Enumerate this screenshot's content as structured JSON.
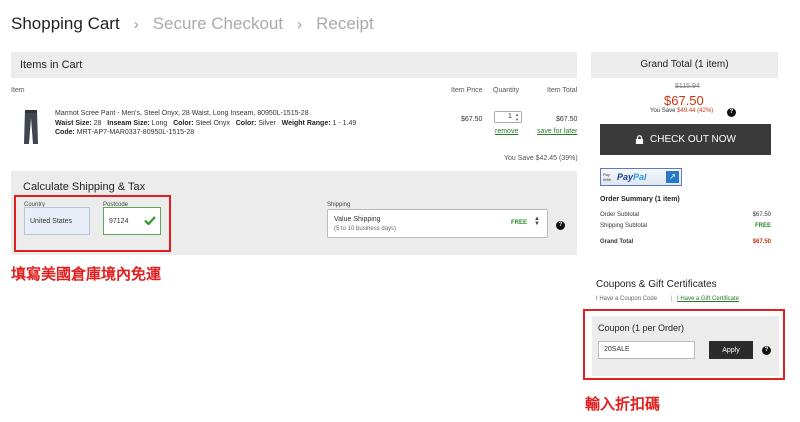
{
  "breadcrumb": {
    "step1": "Shopping Cart",
    "step2": "Secure Checkout",
    "step3": "Receipt",
    "sep": "›"
  },
  "cart": {
    "header": "Items in Cart",
    "col_item": "Item",
    "col_price": "Item Price",
    "col_qty": "Quantity",
    "col_total": "Item Total",
    "product_name": "Marmot Scree Pant - Men's, Steel Onyx, 28 Waist, Long Inseam, 80950L-1515-28",
    "waist_label": "Waist Size:",
    "waist_value": "28",
    "inseam_label": "Inseam Size:",
    "inseam_value": "Long",
    "color_label": "Color:",
    "color_value": "Steel Onyx",
    "color2_label": "Color:",
    "color2_value": "Silver",
    "weight_label": "Weight Range:",
    "weight_value": "1 - 1.49",
    "code_label": "Code:",
    "code_value": "MRT-AP7-MAR0337-80950L-1515-28",
    "price": "$67.50",
    "quantity": "1",
    "remove": "remove",
    "item_total": "$67.50",
    "save_for_later": "save for later",
    "you_save": "You Save $42.45 (39%)"
  },
  "shipping": {
    "title": "Calculate Shipping & Tax",
    "country_label": "Country",
    "country_value": "United States",
    "postcode_label": "Postcode",
    "postcode_value": "97124",
    "shipping_label": "Shipping",
    "method_name": "Value Shipping",
    "method_desc": "(5 to 10 business days)",
    "method_price": "FREE",
    "help": "?"
  },
  "annotations": {
    "shipping_note": "填寫美國倉庫境內免運",
    "coupon_note": "輸入折扣碼",
    "color": "#e02020"
  },
  "summary": {
    "grand_total_header": "Grand Total (1 item)",
    "old_price": "$115.94",
    "price": "$67.50",
    "you_save_prefix": "You Save",
    "you_save_amount": "$49.44 (42%)",
    "help": "?",
    "checkout_label": "CHECK OUT NOW",
    "paypal_paywith": "Pay With",
    "paypal_pay": "Pay",
    "paypal_pal": "Pal",
    "order_summary_title": "Order Summary (1 item)",
    "order_subtotal_label": "Order Subtotal",
    "order_subtotal_value": "$67.50",
    "shipping_subtotal_label": "Shipping Subtotal",
    "shipping_subtotal_value": "FREE",
    "grand_total_label": "Grand Total",
    "grand_total_value": "$67.50"
  },
  "coupons": {
    "title": "Coupons & Gift Certificates",
    "link_coupon": "I Have a Coupon Code",
    "separator": "|",
    "link_gift": "I Have a Gift Certificate",
    "panel_title": "Coupon (1 per Order)",
    "code_value": "20SALE",
    "apply_label": "Apply",
    "help": "?"
  },
  "icons": [
    "chevron-right-icon",
    "lock-icon",
    "check-icon",
    "help-icon",
    "up-down-arrows-icon",
    "paypal-logo"
  ]
}
